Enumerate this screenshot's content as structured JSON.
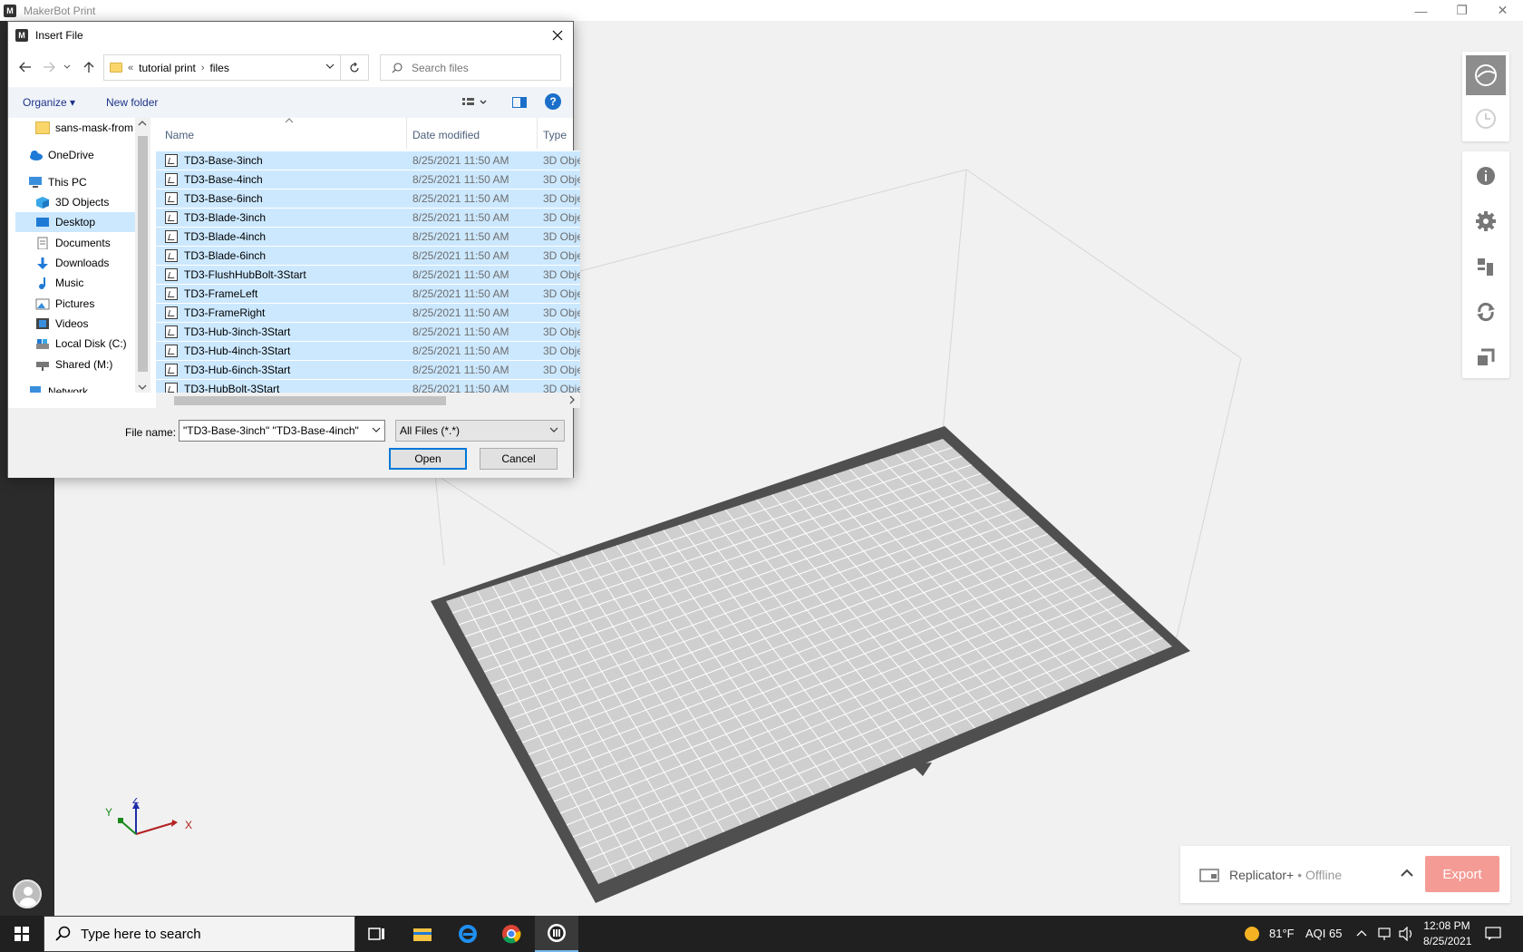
{
  "app": {
    "title": "MakerBot Print",
    "logo_letter": "M",
    "window_buttons": {
      "minimize": "—",
      "restore": "❐",
      "close": "✕"
    }
  },
  "dialog": {
    "title": "Insert File",
    "address": {
      "overflow": "«",
      "crumbs": [
        "tutorial print",
        "files"
      ],
      "separator": "›"
    },
    "search_placeholder": "Search files",
    "command_bar": {
      "organize": "Organize ▾",
      "new_folder": "New folder",
      "help": "?"
    },
    "nav_items": [
      {
        "label": "sans-mask-from",
        "icon": "folder-icon"
      },
      {
        "label": "OneDrive",
        "icon": "cloud-icon"
      },
      {
        "label": "This PC",
        "icon": "computer-icon"
      },
      {
        "label": "3D Objects",
        "icon": "cube-icon"
      },
      {
        "label": "Desktop",
        "icon": "desktop-icon"
      },
      {
        "label": "Documents",
        "icon": "document-icon"
      },
      {
        "label": "Downloads",
        "icon": "download-icon"
      },
      {
        "label": "Music",
        "icon": "music-icon"
      },
      {
        "label": "Pictures",
        "icon": "pictures-icon"
      },
      {
        "label": "Videos",
        "icon": "videos-icon"
      },
      {
        "label": "Local Disk (C:)",
        "icon": "disk-icon"
      },
      {
        "label": "Shared (M:)",
        "icon": "network-drive-icon"
      },
      {
        "label": "Network",
        "icon": "network-icon"
      }
    ],
    "columns": {
      "name": "Name",
      "date": "Date modified",
      "type": "Type"
    },
    "files": [
      {
        "name": "TD3-Base-3inch",
        "date": "8/25/2021 11:50 AM",
        "type": "3D Obje"
      },
      {
        "name": "TD3-Base-4inch",
        "date": "8/25/2021 11:50 AM",
        "type": "3D Obje"
      },
      {
        "name": "TD3-Base-6inch",
        "date": "8/25/2021 11:50 AM",
        "type": "3D Obje"
      },
      {
        "name": "TD3-Blade-3inch",
        "date": "8/25/2021 11:50 AM",
        "type": "3D Obje"
      },
      {
        "name": "TD3-Blade-4inch",
        "date": "8/25/2021 11:50 AM",
        "type": "3D Obje"
      },
      {
        "name": "TD3-Blade-6inch",
        "date": "8/25/2021 11:50 AM",
        "type": "3D Obje"
      },
      {
        "name": "TD3-FlushHubBolt-3Start",
        "date": "8/25/2021 11:50 AM",
        "type": "3D Obje"
      },
      {
        "name": "TD3-FrameLeft",
        "date": "8/25/2021 11:50 AM",
        "type": "3D Obje"
      },
      {
        "name": "TD3-FrameRight",
        "date": "8/25/2021 11:50 AM",
        "type": "3D Obje"
      },
      {
        "name": "TD3-Hub-3inch-3Start",
        "date": "8/25/2021 11:50 AM",
        "type": "3D Obje"
      },
      {
        "name": "TD3-Hub-4inch-3Start",
        "date": "8/25/2021 11:50 AM",
        "type": "3D Obje"
      },
      {
        "name": "TD3-Hub-6inch-3Start",
        "date": "8/25/2021 11:50 AM",
        "type": "3D Obje"
      },
      {
        "name": "TD3-HubBolt-3Start",
        "date": "8/25/2021 11:50 AM",
        "type": "3D Obje"
      }
    ],
    "file_name_label": "File name:",
    "file_name_value": "\"TD3-Base-3inch\" \"TD3-Base-4inch\" \"",
    "file_type_value": "All Files (*.*)",
    "open_button": "Open",
    "cancel_button": "Cancel"
  },
  "axis": {
    "x": "X",
    "y": "Y",
    "z": "Z"
  },
  "printer": {
    "name": "Replicator+",
    "status": "• Offline",
    "export_label": "Export"
  },
  "taskbar": {
    "search_placeholder": "Type here to search",
    "weather_temp": "81°F",
    "aqi": "AQI 65",
    "time": "12:08 PM",
    "date": "8/25/2021"
  },
  "colors": {
    "selection": "#cce8ff",
    "export": "#f59b95",
    "accent": "#0078d7"
  }
}
